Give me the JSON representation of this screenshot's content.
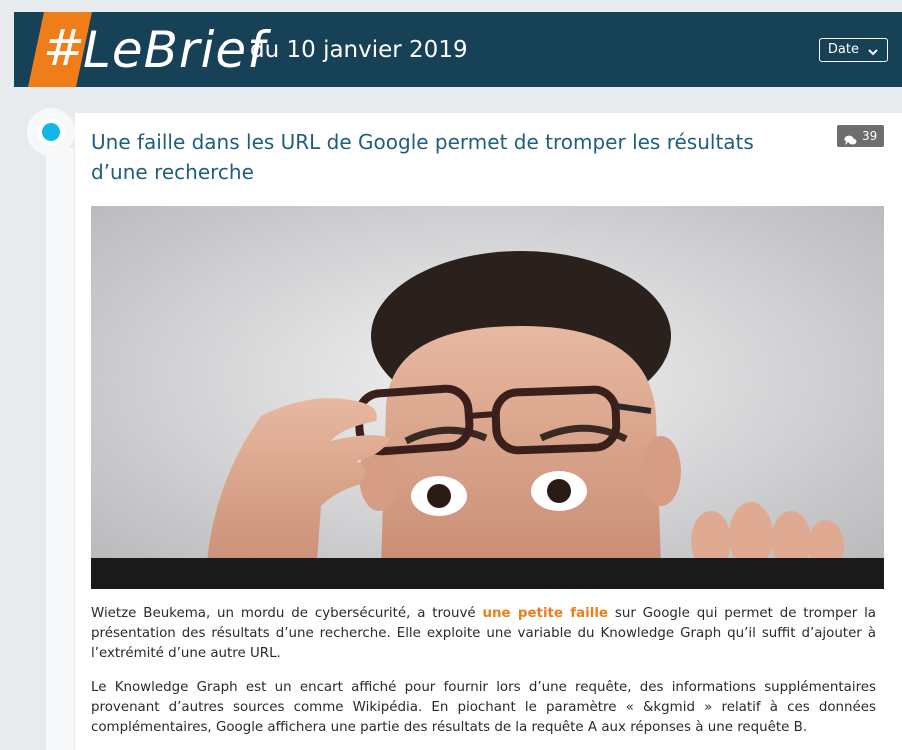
{
  "header": {
    "hash": "#",
    "brand": "LeBrief",
    "date_text": "du 10 janvier 2019",
    "date_button_label": "Date",
    "accent_color": "#ef7d1a",
    "bar_color": "#174157"
  },
  "timeline": {
    "dot_color": "#12b7e7"
  },
  "article": {
    "title": "Une faille dans les URL de Google permet de tromper les résultats d’une recherche",
    "comment_count": "39",
    "comment_icon": "comments-icon",
    "image_icon": "article-photo",
    "paragraph1": {
      "before": "Wietze Beukema, un mordu de cybersécurité, a trouvé ",
      "link": "une petite faille",
      "after": " sur Google qui permet de tromper la présentation des résultats d’une recherche. Elle exploite une variable du Knowledge Graph qu’il suffit d’ajouter à l’extrémité d’une autre URL."
    },
    "paragraph2": "Le Knowledge Graph est un encart affiché pour fournir lors d’une requête, des informations supplémentaires provenant d’autres sources comme Wikipédia. En piochant le paramètre « &kgmid » relatif à ces données complémentaires, Google affichera une partie des résultats de la requête A aux réponses à une requête B."
  }
}
